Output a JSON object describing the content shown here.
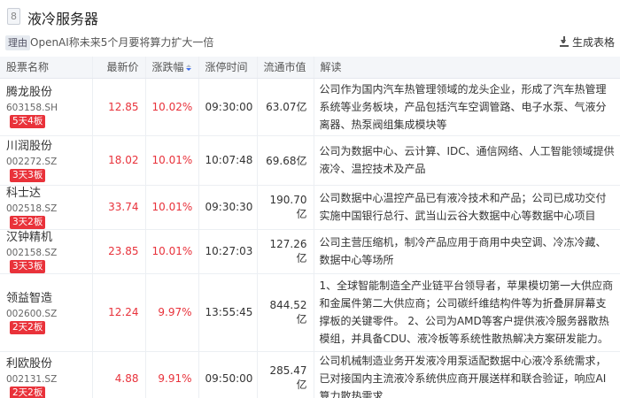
{
  "header": {
    "number": "8",
    "title": "液冷服务器"
  },
  "reason": {
    "tag": "理由",
    "text": "OpenAI称未来5个月要将算力扩大一倍"
  },
  "toolbar": {
    "generate_label": "生成表格"
  },
  "table": {
    "columns": [
      "股票名称",
      "最新价",
      "涨跌幅",
      "涨停时间",
      "流通市值",
      "解读"
    ],
    "rows": [
      {
        "name": "腾龙股份",
        "code": "603158.SH",
        "board": "5天4板",
        "price": "12.85",
        "change": "10.02%",
        "time": "09:30:00",
        "mcap": "63.07亿",
        "desc": "公司作为国内汽车热管理领域的龙头企业，形成了汽车热管理系统等业务板块，产品包括汽车空调管路、电子水泵、气液分离器、热泵阀组集成模块等"
      },
      {
        "name": "川润股份",
        "code": "002272.SZ",
        "board": "3天3板",
        "price": "18.02",
        "change": "10.01%",
        "time": "10:07:48",
        "mcap": "69.68亿",
        "desc": "公司为数据中心、云计算、IDC、通信网络、人工智能领域提供液冷、温控技术及产品"
      },
      {
        "name": "科士达",
        "code": "002518.SZ",
        "board": "3天2板",
        "price": "33.74",
        "change": "10.01%",
        "time": "09:30:30",
        "mcap": "190.70亿",
        "desc": "公司数据中心温控产品已有液冷技术和产品；公司已成功交付实施中国银行总行、武当山云谷大数据中心等数据中心项目"
      },
      {
        "name": "汉钟精机",
        "code": "002158.SZ",
        "board": "3天3板",
        "price": "23.85",
        "change": "10.01%",
        "time": "10:27:03",
        "mcap": "127.26亿",
        "desc": "公司主营压缩机，制冷产品应用于商用中央空调、冷冻冷藏、数据中心等场所"
      },
      {
        "name": "领益智造",
        "code": "002600.SZ",
        "board": "2天2板",
        "price": "12.24",
        "change": "9.97%",
        "time": "13:55:45",
        "mcap": "844.52亿",
        "desc": "1、全球智能制造全产业链平台领导者，苹果模切第一大供应商和金属件第二大供应商；公司碳纤维结构件等为折叠屏屏幕支撑板的关键零件。 2、公司为AMD等客户提供液冷服务器散热模组，并具备CDU、液冷板等系统性散热解决方案研发能力。"
      },
      {
        "name": "利欧股份",
        "code": "002131.SZ",
        "board": "2天2板",
        "price": "4.88",
        "change": "9.91%",
        "time": "09:50:00",
        "mcap": "285.47亿",
        "desc": "公司机械制造业务开发液冷用泵适配数据中心液冷系统需求，已对接国内主流液冷系统供应商开展送样和联合验证，响应AI算力散热需求"
      }
    ]
  },
  "colors": {
    "accent_red": "#e8323b",
    "board_red": "#e9323a",
    "sort_active": "#3b6cf0"
  },
  "icons": {
    "generate": "download-icon",
    "sort": "sort-icon"
  }
}
